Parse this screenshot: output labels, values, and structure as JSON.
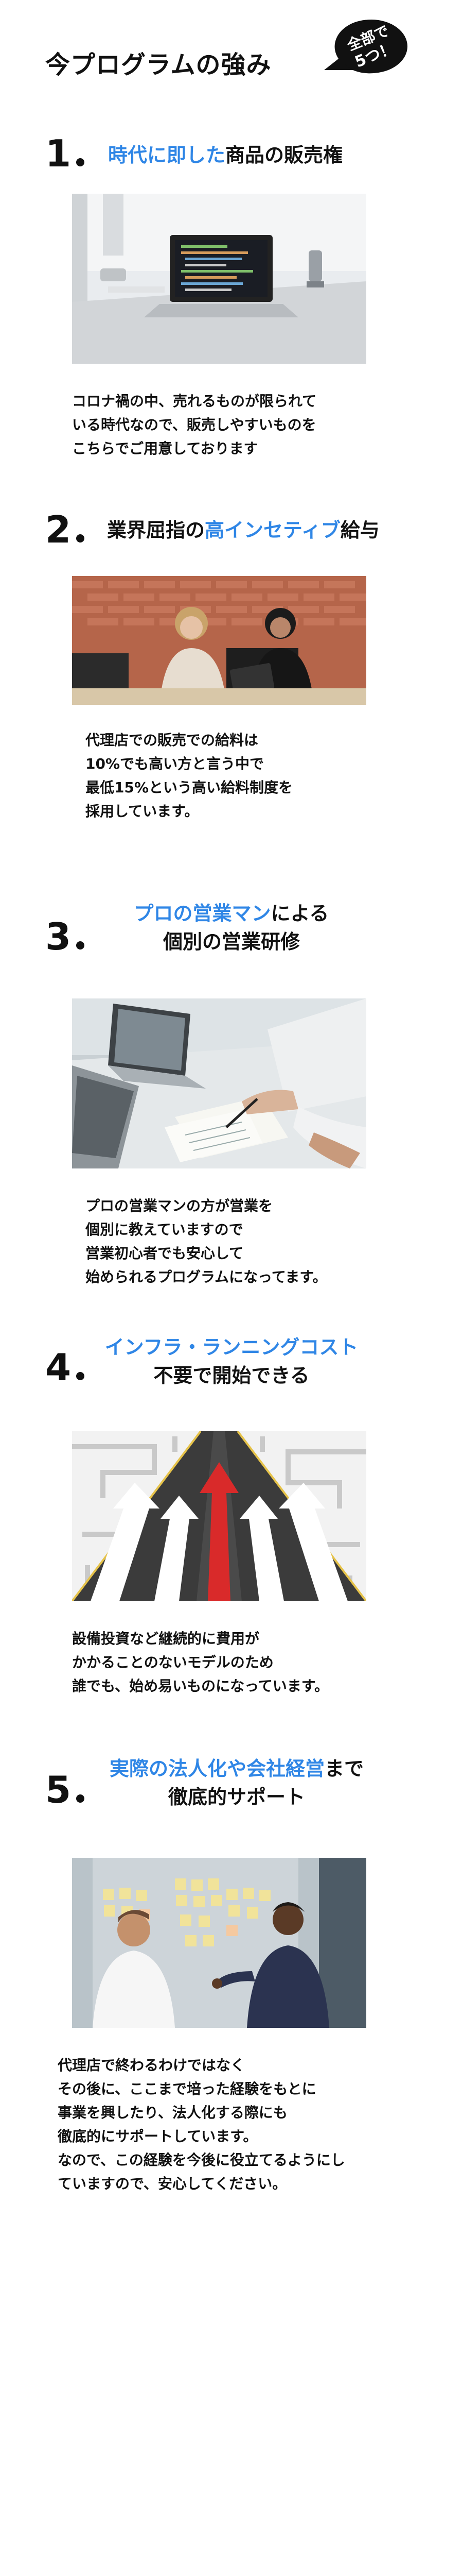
{
  "title": "今プログラムの強み",
  "badge": {
    "line1": "全部で",
    "line2": "5つ！"
  },
  "sections": [
    {
      "number": "1",
      "heading": {
        "pre": "",
        "highlight": "時代に即した",
        "post": "商品の販売権",
        "line2": ""
      },
      "image_subject": "laptop-with-code",
      "body": [
        "コロナ禍の中、売れるものが限られて",
        "いる時代なので、販売しやすいものを",
        "こちらでご用意しております"
      ]
    },
    {
      "number": "2",
      "heading": {
        "pre": "業界屈指の",
        "highlight": "高インセティブ",
        "post": "給与",
        "line2": ""
      },
      "image_subject": "two-women-meeting",
      "body": [
        "代理店での販売での給料は",
        "10%でも高い方と言う中で",
        "最低15%という高い給料制度を",
        "採用しています。"
      ]
    },
    {
      "number": "3",
      "heading": {
        "pre": "",
        "highlight": "プロの営業マン",
        "post": "による",
        "line2": "個別の営業研修"
      },
      "image_subject": "desk-with-laptops-and-papers",
      "body": [
        "プロの営業マンの方が営業を",
        "個別に教えていますので",
        "営業初心者でも安心して",
        "始められるプログラムになってます。"
      ]
    },
    {
      "number": "4",
      "heading": {
        "pre": "",
        "highlight": "インフラ・ランニングコスト",
        "post": "",
        "line2": "不要で開始できる"
      },
      "image_subject": "road-with-arrows",
      "body": [
        "設備投資など継続的に費用が",
        "かかることのないモデルのため",
        "誰でも、始め易いものになっています。"
      ]
    },
    {
      "number": "5",
      "heading": {
        "pre": "",
        "highlight": "実際の法人化や会社経営",
        "post": "まで",
        "line2": "徹底的サポート"
      },
      "image_subject": "two-men-sticky-notes",
      "body": [
        "代理店で終わるわけではなく",
        "その後に、ここまで培った経験をもとに",
        "事業を興したり、法人化する際にも",
        "徹底的にサポートしています。",
        "なので、この経験を今後に役立てるようにし",
        "ていますので、安心してください。"
      ]
    }
  ]
}
